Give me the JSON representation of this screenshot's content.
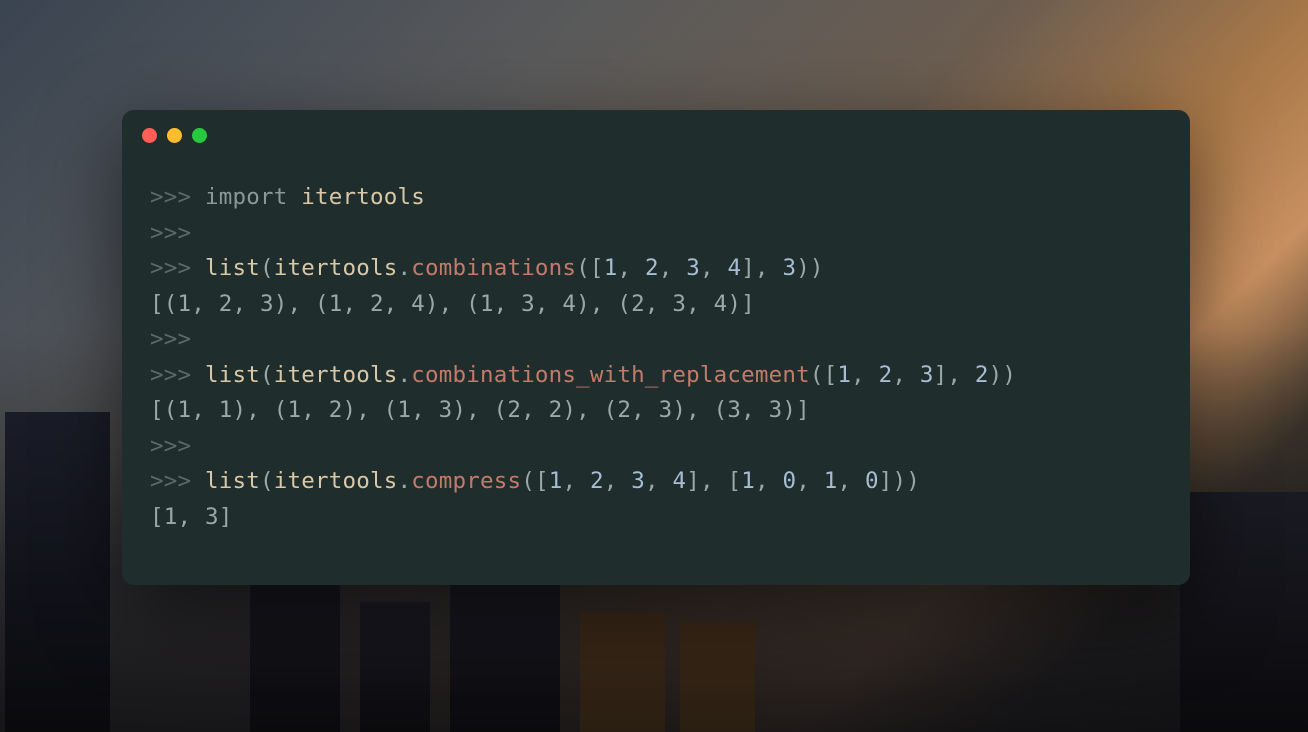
{
  "code": {
    "prompt": ">>> ",
    "empty_prompt": ">>>",
    "line1": {
      "kw": "import",
      "sp": " ",
      "mod": "itertools"
    },
    "line3": {
      "fn": "list",
      "op": "(",
      "obj": "itertools",
      "dot": ".",
      "call": "combinations",
      "op2": "([",
      "n1": "1",
      "c": ", ",
      "n2": "2",
      "n3": "3",
      "n4": "4",
      "cb": "], ",
      "arg": "3",
      "cp": "))"
    },
    "out1": "[(1, 2, 3), (1, 2, 4), (1, 3, 4), (2, 3, 4)]",
    "line5": {
      "fn": "list",
      "op": "(",
      "obj": "itertools",
      "dot": ".",
      "call": "combinations_with_replacement",
      "op2": "([",
      "n1": "1",
      "c": ", ",
      "n2": "2",
      "n3": "3",
      "cb": "], ",
      "arg": "2",
      "cp": "))"
    },
    "out2": "[(1, 1), (1, 2), (1, 3), (2, 2), (2, 3), (3, 3)]",
    "line7": {
      "fn": "list",
      "op": "(",
      "obj": "itertools",
      "dot": ".",
      "call": "compress",
      "op2": "([",
      "n1": "1",
      "c": ", ",
      "n2": "2",
      "n3": "3",
      "n4": "4",
      "mid": "], [",
      "m1": "1",
      "m2": "0",
      "m3": "1",
      "m4": "0",
      "cp": "]))"
    },
    "out3": "[1, 3]"
  }
}
